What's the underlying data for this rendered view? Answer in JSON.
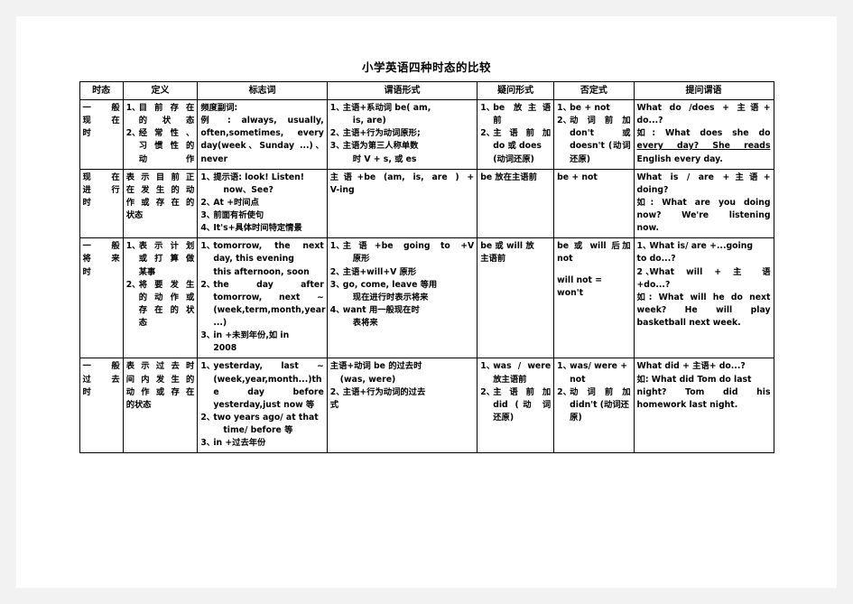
{
  "document": {
    "title": "小学英语四种时态的比较"
  },
  "table": {
    "headers": [
      "时态",
      "定义",
      "标志词",
      "谓语形式",
      "疑问形式",
      "否定式",
      "提问谓语"
    ],
    "rows": [
      {
        "tense": "一般现在时",
        "tense_lines": [
          "一 般",
          "现 在",
          "时"
        ],
        "definition": {
          "items": [
            {
              "num": "1、",
              "lines": [
                "目前存在",
                "的状态"
              ]
            },
            {
              "num": "2、",
              "lines": [
                "经常性、",
                "习惯性的",
                "动作"
              ]
            }
          ]
        },
        "markers": {
          "intro": "频度副词:",
          "lines": [
            "例 : always, usually,",
            "often,sometimes, every",
            "day(week、Sunday ...)、",
            "never"
          ]
        },
        "predicate": {
          "items": [
            {
              "num": "1、",
              "lines": [
                "主语+系动词 be( am,",
                "is, are)"
              ]
            },
            {
              "num": "2、",
              "lines": [
                "主语+行为动词原形;"
              ]
            },
            {
              "num": "3、",
              "lines": [
                "主语为第三人称单数",
                "时 V + s, 或 es"
              ]
            }
          ]
        },
        "question": {
          "items": [
            {
              "num": "1、",
              "lines": [
                "be 放主语",
                "前"
              ]
            },
            {
              "num": "2、",
              "lines": [
                "主 语 前 加",
                "do 或 does",
                "(动词还原)"
              ]
            }
          ]
        },
        "negative": {
          "items": [
            {
              "num": "1、",
              "lines": [
                "be + not"
              ]
            },
            {
              "num": "2、",
              "lines": [
                "动 词 前 加",
                "don't 或",
                "doesn't (动词",
                "还原)"
              ]
            }
          ]
        },
        "ask_predicate": {
          "lines": [
            "What do /does + 主语+",
            "do...?",
            "如: What does she do",
            "every day? She reads",
            "English every day."
          ]
        }
      },
      {
        "tense": "现在进行时",
        "tense_lines": [
          "现 在",
          "进 行",
          "时"
        ],
        "definition": {
          "lines": [
            "表示目前正",
            "在发生的动",
            "作或存在的",
            "状态"
          ]
        },
        "markers": {
          "items": [
            {
              "num": "1、",
              "lines": [
                "提示语: look! Listen!",
                "now、See?"
              ]
            },
            {
              "num": "2、",
              "lines": [
                "At +时间点"
              ]
            },
            {
              "num": "3、",
              "lines": [
                "前面有祈使句"
              ]
            },
            {
              "num": "4、",
              "lines": [
                "It's+具体时间特定情景"
              ]
            }
          ]
        },
        "predicate": {
          "lines": [
            "主语+be (am, is, are ) +",
            "V-ing"
          ]
        },
        "question": {
          "lines": [
            "be 放在主语前"
          ]
        },
        "negative": {
          "lines": [
            "be + not"
          ]
        },
        "ask_predicate": {
          "lines": [
            "What is / are +主语+",
            "doing?",
            "如: What are you doing",
            "now? We're listening",
            "now."
          ]
        }
      },
      {
        "tense": "一般将来时",
        "tense_lines": [
          "一 般",
          "将 来",
          "时"
        ],
        "definition": {
          "items": [
            {
              "num": "1、",
              "lines": [
                "表示计划",
                "或打算做",
                "某事"
              ]
            },
            {
              "num": "2、",
              "lines": [
                "将要发生",
                "的动作或",
                "存在的状",
                "态"
              ]
            }
          ]
        },
        "markers": {
          "items": [
            {
              "num": "1、",
              "lines": [
                "tomorrow, the next",
                "day, this evening",
                "this afternoon, soon"
              ]
            },
            {
              "num": "2、",
              "lines": [
                "the day after",
                "tomorrow, next ~",
                "(week,term,month,year",
                "...)"
              ]
            },
            {
              "num": "3、",
              "lines": [
                "in +未到年份,如 in",
                "2008"
              ]
            }
          ]
        },
        "predicate": {
          "items": [
            {
              "num": "1、",
              "lines": [
                "主语+be going to +V",
                "原形"
              ]
            },
            {
              "num": "2、",
              "lines": [
                "主语+will+V 原形"
              ]
            },
            {
              "num": "3、",
              "lines": [
                "go, come, leave 等用",
                "现在进行时表示将来"
              ]
            },
            {
              "num": "4、",
              "lines": [
                "want 用一般现在时",
                "表将来"
              ]
            }
          ]
        },
        "question": {
          "lines": [
            "be 或 will 放",
            "主语前"
          ]
        },
        "negative": {
          "lines": [
            "be 或 will 后加",
            "not"
          ],
          "extra": "will not = won't"
        },
        "ask_predicate": {
          "items": [
            {
              "num": "1、",
              "lines": [
                "What is/ are +...going",
                "to do...?"
              ]
            },
            {
              "num": "2 、",
              "lines": [
                "What will + 主 语",
                "+do...?"
              ]
            }
          ],
          "example": [
            "如: What will he do next",
            "week? He will play",
            "basketball next week."
          ]
        }
      },
      {
        "tense": "一般过去时",
        "tense_lines": [
          "一 般",
          "过 去",
          "时"
        ],
        "definition": {
          "lines": [
            "表示过去时",
            "间内发生的",
            "动作或存在",
            "的状态"
          ]
        },
        "markers": {
          "items": [
            {
              "num": "1、",
              "lines": [
                "yesterday, last ~",
                "(week,year,month...)th",
                "e day before",
                "yesterday,just now 等"
              ]
            },
            {
              "num": "2、",
              "lines": [
                "two years ago/ at that",
                "time/ before 等"
              ]
            },
            {
              "num": "3、",
              "lines": [
                "in +过去年份"
              ]
            }
          ]
        },
        "predicate": {
          "head": [
            "主语+动词 be 的过去时",
            "(was, were)"
          ],
          "items": [
            {
              "num": "2、",
              "lines": [
                "主语+行为动词的过去",
                "式"
              ]
            }
          ]
        },
        "question": {
          "items": [
            {
              "num": "1、",
              "lines": [
                "was / were",
                "放主语前"
              ]
            },
            {
              "num": "2、",
              "lines": [
                "主 语 前 加",
                "did (动 词",
                "还原)"
              ]
            }
          ]
        },
        "negative": {
          "items": [
            {
              "num": "1、",
              "lines": [
                "was/ were + not"
              ]
            },
            {
              "num": "2、",
              "lines": [
                "动 词 前 加",
                "didn't (动词还",
                "原)"
              ]
            }
          ]
        },
        "ask_predicate": {
          "lines": [
            "What did + 主语+ do...?",
            "如: What did Tom do last",
            "night? Tom did his",
            "homework last night."
          ]
        }
      }
    ]
  }
}
